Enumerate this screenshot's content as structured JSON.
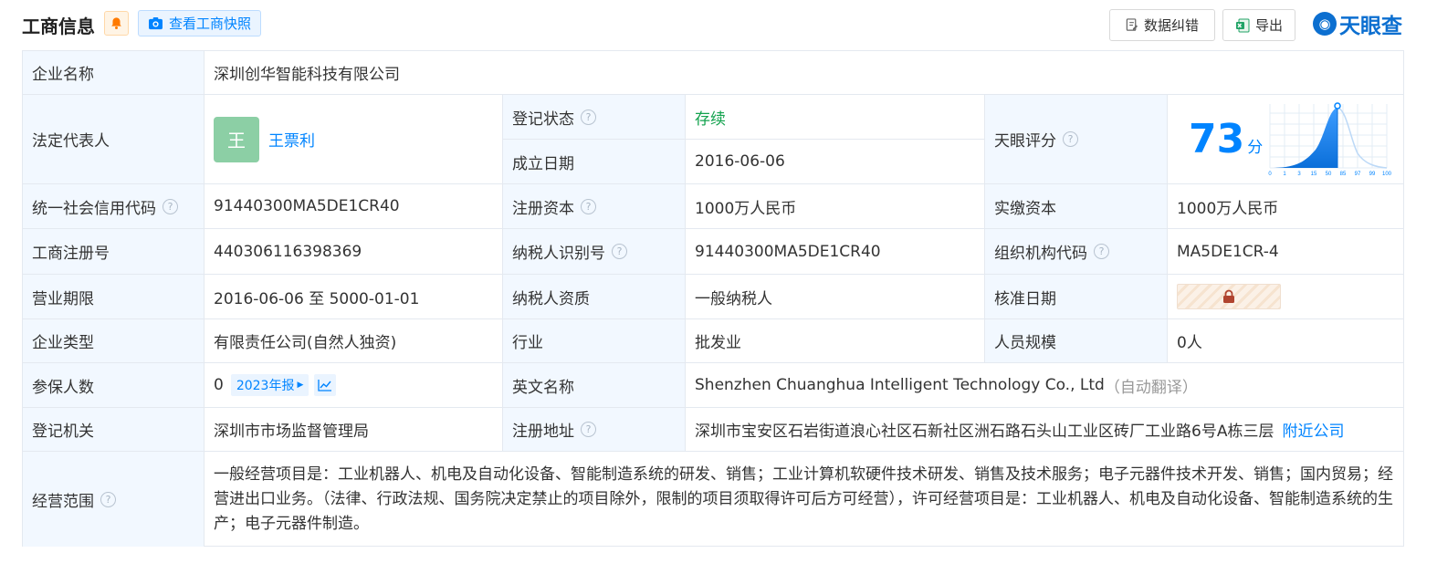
{
  "header": {
    "title": "工商信息",
    "snapshot_label": "查看工商快照",
    "correct_label": "数据纠错",
    "export_label": "导出",
    "logo_text": "天眼查"
  },
  "labels": {
    "company_name": "企业名称",
    "legal_rep": "法定代表人",
    "reg_status": "登记状态",
    "founded": "成立日期",
    "tianyan_score": "天眼评分",
    "credit_code": "统一社会信用代码",
    "reg_capital": "注册资本",
    "paid_capital": "实缴资本",
    "reg_number": "工商注册号",
    "taxpayer_id": "纳税人识别号",
    "org_code": "组织机构代码",
    "biz_term": "营业期限",
    "taxpayer_qual": "纳税人资质",
    "approval_date": "核准日期",
    "company_type": "企业类型",
    "industry": "行业",
    "staff_size": "人员规模",
    "insured": "参保人数",
    "english_name": "英文名称",
    "reg_authority": "登记机关",
    "reg_address": "注册地址",
    "biz_scope": "经营范围"
  },
  "values": {
    "company_name": "深圳创华智能科技有限公司",
    "legal_rep_avatar": "王",
    "legal_rep": "王票利",
    "reg_status": "存续",
    "founded": "2016-06-06",
    "score": "73",
    "score_unit": "分",
    "credit_code": "91440300MA5DE1CR40",
    "reg_capital": "1000万人民币",
    "paid_capital": "1000万人民币",
    "reg_number": "440306116398369",
    "taxpayer_id": "91440300MA5DE1CR40",
    "org_code": "MA5DE1CR-4",
    "biz_term": "2016-06-06 至 5000-01-01",
    "taxpayer_qual": "一般纳税人",
    "company_type": "有限责任公司(自然人独资)",
    "industry": "批发业",
    "staff_size": "0人",
    "insured": "0",
    "insured_year_tag": "2023年报",
    "english_name": "Shenzhen Chuanghua Intelligent Technology Co., Ltd",
    "english_name_note": "（自动翻译）",
    "reg_authority": "深圳市市场监督管理局",
    "reg_address": "深圳市宝安区石岩街道浪心社区石新社区洲石路石头山工业区砖厂工业路6号A栋三层",
    "nearby_link": "附近公司",
    "biz_scope": "一般经营项目是：工业机器人、机电及自动化设备、智能制造系统的研发、销售；工业计算机软硬件技术研发、销售及技术服务；电子元器件技术开发、销售；国内贸易；经营进出口业务。（法律、行政法规、国务院决定禁止的项目除外，限制的项目须取得许可后方可经营），许可经营项目是：工业机器人、机电及自动化设备、智能制造系统的生产；电子元器件制造。"
  },
  "score_chart": {
    "ticks": [
      "0",
      "1",
      "3",
      "15",
      "50",
      "85",
      "97",
      "99",
      "100"
    ]
  },
  "colors": {
    "accent": "#0084ff",
    "status_green": "#13a24e",
    "label_bg": "#f2f8ff",
    "border": "#e4e9f0"
  }
}
